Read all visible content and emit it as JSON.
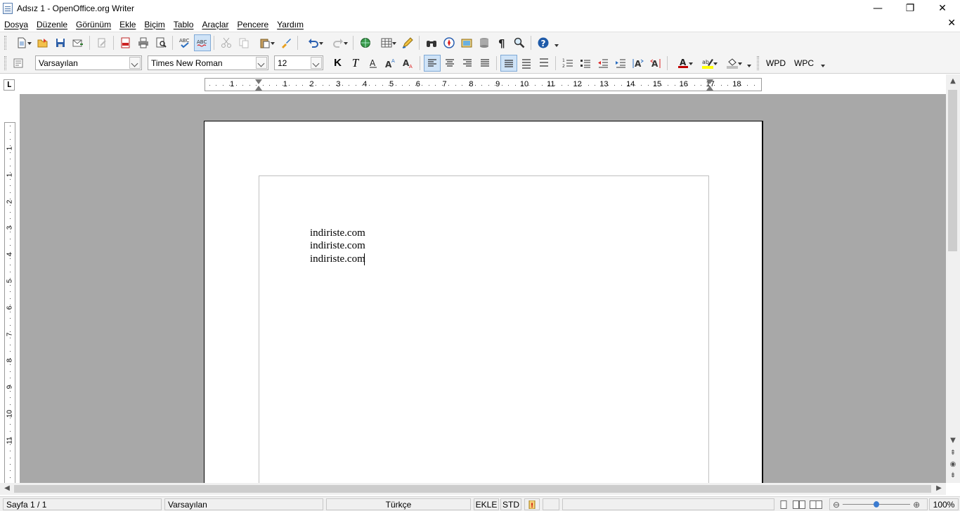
{
  "window": {
    "title": "Adsız 1 - OpenOffice.org Writer",
    "minimize_glyph": "—",
    "restore_glyph": "❐",
    "close_glyph": "✕"
  },
  "menu": [
    {
      "label": "Dosya"
    },
    {
      "label": "Düzenle"
    },
    {
      "label": "Görünüm"
    },
    {
      "label": "Ekle"
    },
    {
      "label": "Biçim"
    },
    {
      "label": "Tablo"
    },
    {
      "label": "Araçlar"
    },
    {
      "label": "Pencere"
    },
    {
      "label": "Yardım"
    }
  ],
  "document_close_glyph": "✕",
  "formatting": {
    "paragraph_style": "Varsayılan",
    "font_name": "Times New Roman",
    "font_size": "12",
    "bold_label": "K",
    "italic_label": "T",
    "wpd_label": "WPD",
    "wpc_label": "WPC"
  },
  "ruler": {
    "tab_type_glyph": "L",
    "horizontal_numbers": [
      "1",
      "1",
      "2",
      "3",
      "4",
      "5",
      "6",
      "7",
      "8",
      "9",
      "10",
      "11",
      "12",
      "13",
      "14",
      "15",
      "16",
      "17",
      "18"
    ],
    "vertical_numbers": [
      "1",
      "1",
      "2",
      "3",
      "4",
      "5",
      "6",
      "7",
      "8",
      "9",
      "10",
      "11"
    ]
  },
  "document": {
    "lines": [
      "indiriste.com",
      "indiriste.com",
      "indiriste.com"
    ]
  },
  "status": {
    "page": "Sayfa 1 / 1",
    "style": "Varsayılan",
    "language": "Türkçe",
    "insert_mode": "EKLE",
    "selection_mode": "STD",
    "zoom": "100%",
    "zoom_level": 1.0
  },
  "colors": {
    "workspace": "#a8a8a8",
    "toolbar": "#f4f4f4",
    "active_button": "#cfe3f7",
    "help_icon": "#1e5aa8"
  }
}
